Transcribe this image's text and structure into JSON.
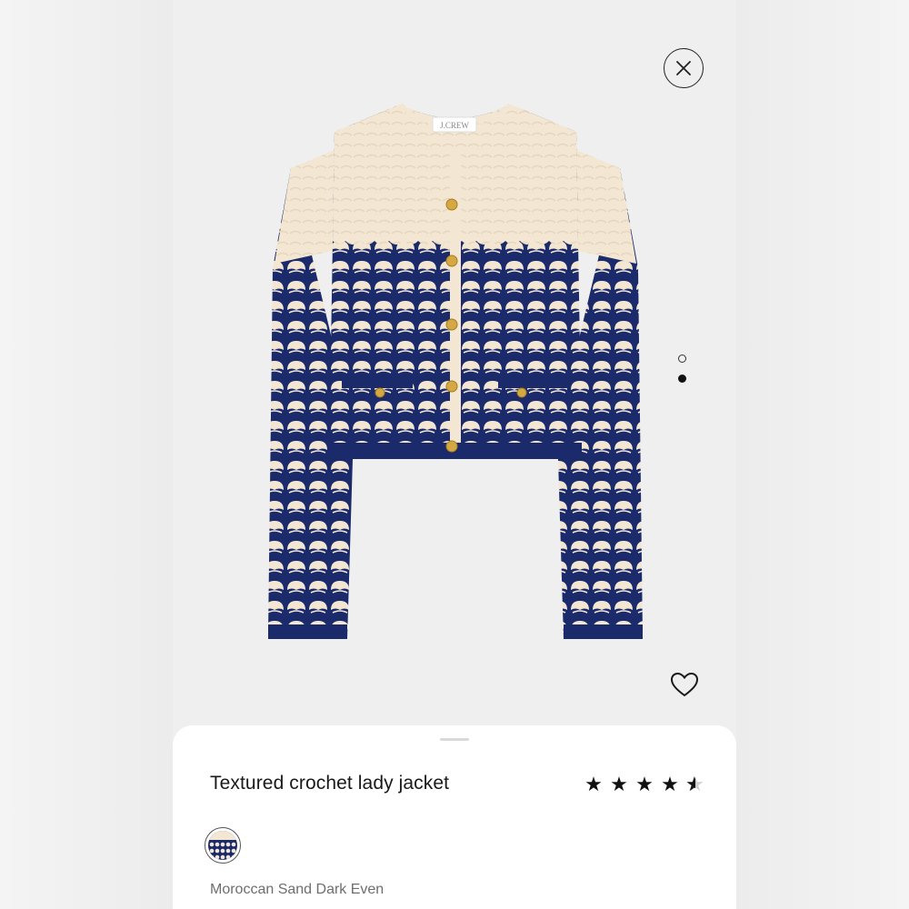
{
  "product": {
    "title": "Textured crochet lady jacket",
    "brand_label": "J.CREW",
    "rating": 4.5,
    "stars": [
      "★",
      "★",
      "★",
      "★"
    ],
    "half_star": "★",
    "color_name": "Moroccan Sand Dark Even"
  },
  "gallery": {
    "image_count": 2,
    "active_index": 1
  },
  "icons": {
    "close": "close-icon",
    "favorite": "heart-icon",
    "star": "star-icon"
  },
  "colors": {
    "cream": "#f3e7d4",
    "navy": "#1b2a6b",
    "gold": "#d4a843",
    "page_bg": "#efefef"
  }
}
